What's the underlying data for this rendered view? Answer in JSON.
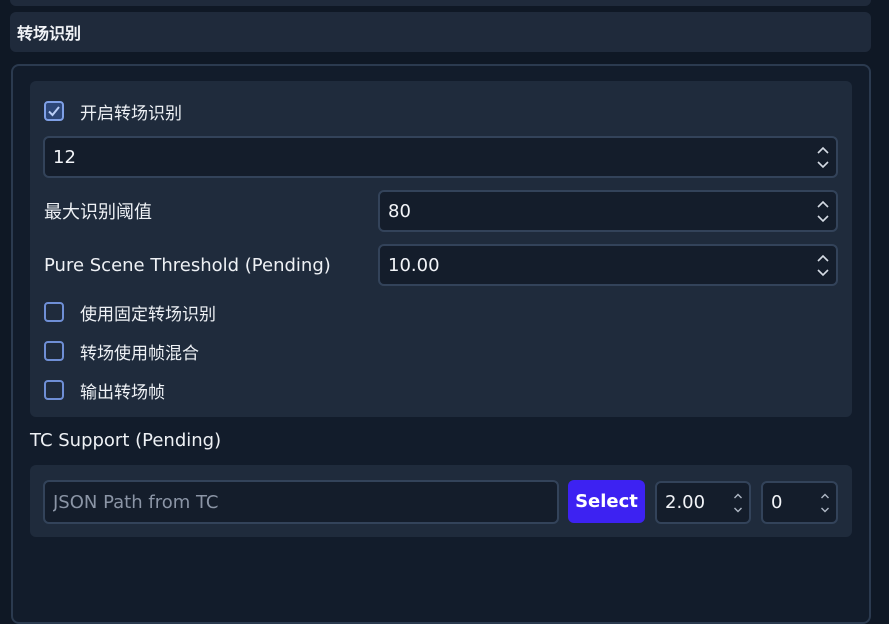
{
  "section": {
    "title": "转场识别"
  },
  "main": {
    "enable_checkbox": {
      "label": "开启转场识别",
      "checked": true
    },
    "frame_count_spin": {
      "value": "12"
    },
    "max_threshold": {
      "label": "最大识别阈值",
      "value": "80"
    },
    "pure_scene_threshold": {
      "label": "Pure Scene Threshold (Pending)",
      "value": "10.00"
    },
    "checkboxes": [
      {
        "label": "使用固定转场识别",
        "checked": false
      },
      {
        "label": "转场使用帧混合",
        "checked": false
      },
      {
        "label": "输出转场帧",
        "checked": false
      }
    ]
  },
  "tc_support": {
    "title": "TC Support (Pending)",
    "path_placeholder": "JSON Path from TC",
    "path_value": "",
    "select_label": "Select",
    "spin_a": {
      "value": "2.00"
    },
    "spin_b": {
      "value": "0"
    }
  },
  "colors": {
    "accent": "#3d22f2",
    "panel": "#1f2b3c",
    "background": "#0f1825"
  }
}
